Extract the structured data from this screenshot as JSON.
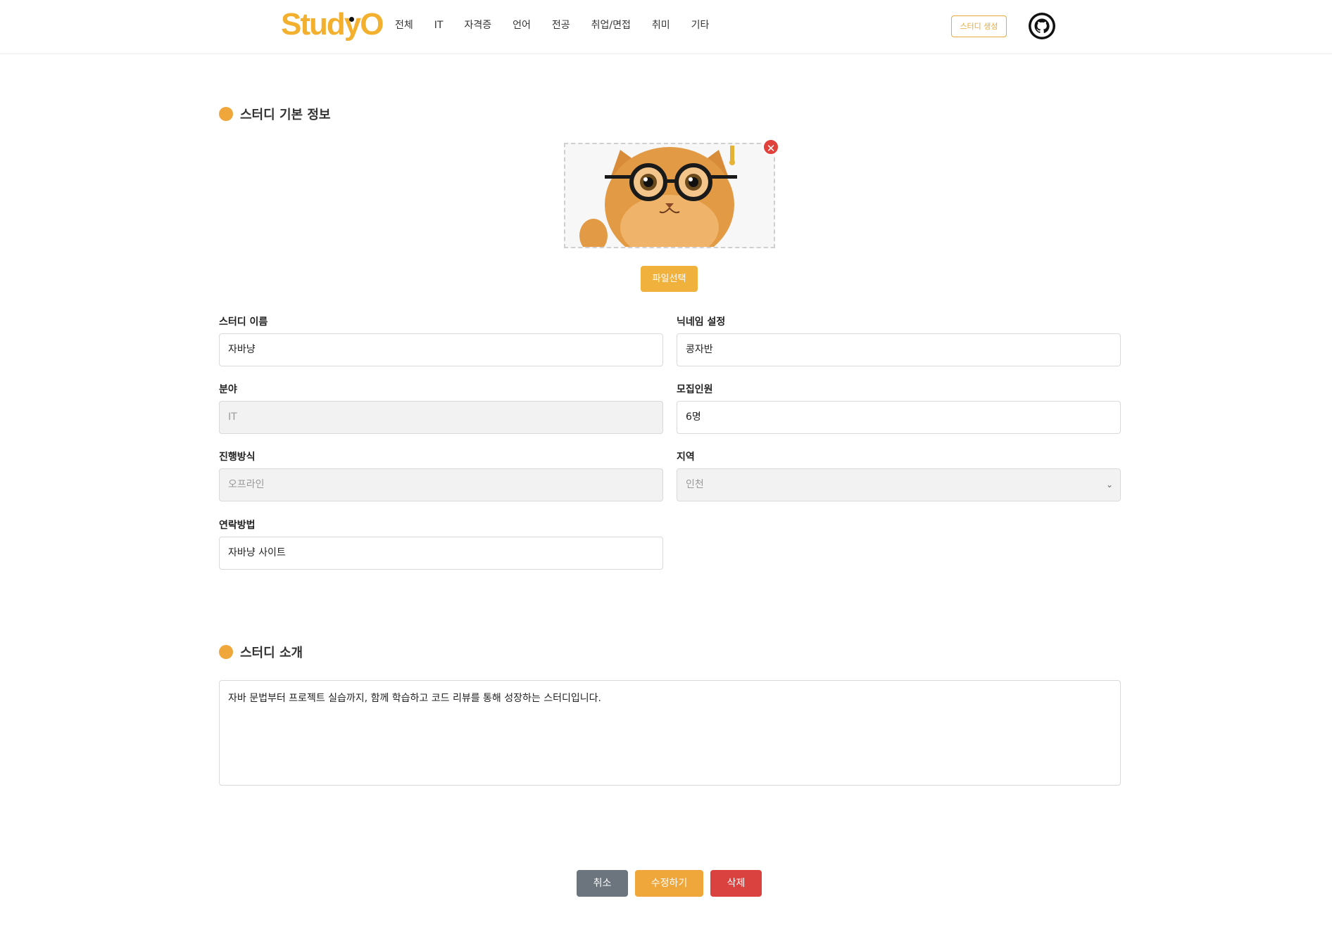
{
  "header": {
    "logo": "StudyO",
    "nav": [
      "전체",
      "IT",
      "자격증",
      "언어",
      "전공",
      "취업/면접",
      "취미",
      "기타"
    ],
    "create_label": "스터디 생성"
  },
  "basic_section": {
    "title": "스터디 기본 정보"
  },
  "image_upload": {
    "remove_symbol": "✕",
    "file_button": "파일선택"
  },
  "form": {
    "study_name": {
      "label": "스터디 이름",
      "value": "자바냥"
    },
    "nickname": {
      "label": "닉네임 설정",
      "value": "콩자반"
    },
    "category": {
      "label": "분야",
      "value": "IT"
    },
    "capacity": {
      "label": "모집인원",
      "value": "6명"
    },
    "mode": {
      "label": "진행방식",
      "value": "오프라인"
    },
    "region": {
      "label": "지역",
      "value": "인천"
    },
    "contact": {
      "label": "연락방법",
      "value": "자바냥 사이트"
    }
  },
  "intro_section": {
    "title": "스터디 소개",
    "text": "자바 문법부터 프로젝트 실습까지, 함께 학습하고 코드 리뷰를 통해 성장하는 스터디입니다."
  },
  "actions": {
    "cancel": "취소",
    "edit": "수정하기",
    "delete": "삭제"
  },
  "colors": {
    "accent": "#efa73b",
    "delete": "#d9423f",
    "cancel": "#6c757d"
  }
}
